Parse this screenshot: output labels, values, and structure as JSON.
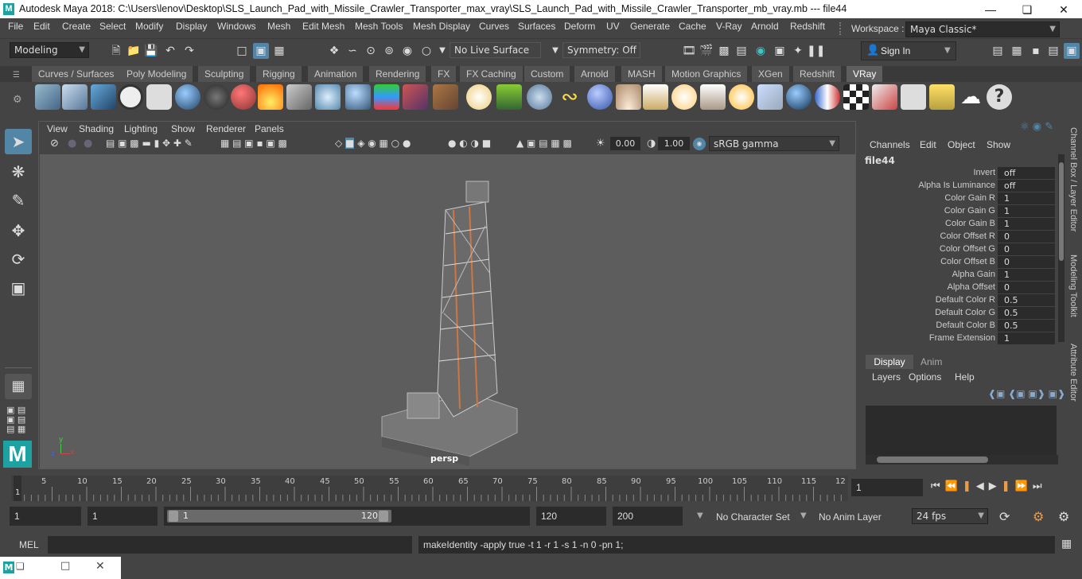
{
  "window": {
    "title": "Autodesk Maya 2018: C:\\Users\\lenov\\Desktop\\SLS_Launch_Pad_with_Missile_Crawler_Transporter_max_vray\\SLS_Launch_Pad_with_Missile_Crawler_Transporter_mb_vray.mb   ---   file44",
    "logo_letter": "M"
  },
  "menubar": {
    "items": [
      "File",
      "Edit",
      "Create",
      "Select",
      "Modify",
      "Display",
      "Windows",
      "Mesh",
      "Edit Mesh",
      "Mesh Tools",
      "Mesh Display",
      "Curves",
      "Surfaces",
      "Deform",
      "UV",
      "Generate",
      "Cache",
      "V-Ray",
      "Arnold",
      "Redshift"
    ],
    "workspace_label": "Workspace :",
    "workspace_value": "Maya Classic*"
  },
  "toolbar": {
    "mode": "Modeling",
    "live_surface": "No Live Surface",
    "symmetry": "Symmetry: Off",
    "sign_in": "Sign In"
  },
  "shelf": {
    "tabs": [
      "Curves / Surfaces",
      "Poly Modeling",
      "Sculpting",
      "Rigging",
      "Animation",
      "Rendering",
      "FX",
      "FX Caching",
      "Custom",
      "Arnold",
      "MASH",
      "Motion Graphics",
      "XGen",
      "Redshift",
      "VRay"
    ],
    "active_tab": "VRay"
  },
  "viewport": {
    "menus": [
      "View",
      "Shading",
      "Lighting",
      "Show",
      "Renderer",
      "Panels"
    ],
    "exposure": "0.00",
    "gamma": "1.00",
    "color_space": "sRGB gamma",
    "camera_label": "persp"
  },
  "channel_box": {
    "menus": [
      "Channels",
      "Edit",
      "Object",
      "Show"
    ],
    "node_name": "file44",
    "attributes": [
      {
        "name": "Invert",
        "value": "off"
      },
      {
        "name": "Alpha Is Luminance",
        "value": "off"
      },
      {
        "name": "Color Gain R",
        "value": "1"
      },
      {
        "name": "Color Gain G",
        "value": "1"
      },
      {
        "name": "Color Gain B",
        "value": "1"
      },
      {
        "name": "Color Offset R",
        "value": "0"
      },
      {
        "name": "Color Offset G",
        "value": "0"
      },
      {
        "name": "Color Offset B",
        "value": "0"
      },
      {
        "name": "Alpha Gain",
        "value": "1"
      },
      {
        "name": "Alpha Offset",
        "value": "0"
      },
      {
        "name": "Default Color R",
        "value": "0.5"
      },
      {
        "name": "Default Color G",
        "value": "0.5"
      },
      {
        "name": "Default Color B",
        "value": "0.5"
      },
      {
        "name": "Frame Extension",
        "value": "1"
      }
    ]
  },
  "layer_editor": {
    "tabs": [
      "Display",
      "Anim"
    ],
    "menus": [
      "Layers",
      "Options",
      "Help"
    ]
  },
  "side_tabs": [
    "Channel Box / Layer Editor",
    "Modeling Toolkit",
    "Attribute Editor"
  ],
  "timeline": {
    "ticks": [
      "5",
      "10",
      "15",
      "20",
      "25",
      "30",
      "35",
      "40",
      "45",
      "50",
      "55",
      "60",
      "65",
      "70",
      "75",
      "80",
      "85",
      "90",
      "95",
      "100",
      "105",
      "110",
      "115",
      "12"
    ],
    "start_marker": "1",
    "current_frame": "1"
  },
  "range": {
    "start": "1",
    "playback_start": "1",
    "slider_start": "1",
    "slider_end": "120",
    "playback_end": "120",
    "end": "200",
    "character_set": "No Character Set",
    "anim_layer": "No Anim Layer",
    "fps": "24 fps"
  },
  "command_line": {
    "language": "MEL",
    "result": "makeIdentity -apply true -t 1 -r 1 -s 1 -n 0 -pn 1;"
  },
  "colors": {
    "accent": "#5285a6",
    "panel": "#444444",
    "field": "#2b2b2b",
    "viewport_bg": "#5d5d5d"
  }
}
